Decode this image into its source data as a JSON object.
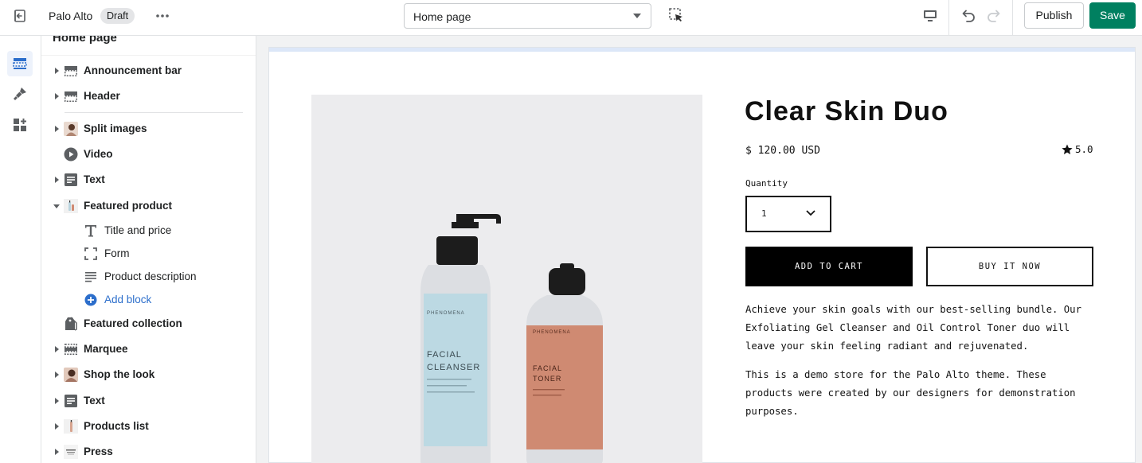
{
  "topbar": {
    "store_name": "Palo Alto",
    "status_badge": "Draft",
    "page_select_value": "Home page",
    "publish_label": "Publish",
    "save_label": "Save",
    "save_color": "#008060"
  },
  "sidebar": {
    "title": "Home page",
    "sections": [
      {
        "label": "Announcement bar",
        "icon": "layout-bar-icon"
      },
      {
        "label": "Header",
        "icon": "layout-header-icon"
      },
      {
        "label": "Split images",
        "icon": "image-thumbnail-icon"
      },
      {
        "label": "Video",
        "icon": "play-circle-icon"
      },
      {
        "label": "Text",
        "icon": "text-block-icon"
      },
      {
        "label": "Featured product",
        "icon": "product-thumbnail-icon",
        "expanded": true,
        "blocks": [
          {
            "label": "Title and price",
            "icon": "type-icon"
          },
          {
            "label": "Form",
            "icon": "form-frame-icon"
          },
          {
            "label": "Product description",
            "icon": "align-left-icon"
          }
        ],
        "add_block_label": "Add block"
      },
      {
        "label": "Featured collection",
        "icon": "collection-tag-icon"
      },
      {
        "label": "Marquee",
        "icon": "layout-bar-icon"
      },
      {
        "label": "Shop the look",
        "icon": "image-thumbnail-icon"
      },
      {
        "label": "Text",
        "icon": "text-block-icon"
      },
      {
        "label": "Products list",
        "icon": "product-thumbnail-icon"
      },
      {
        "label": "Press",
        "icon": "press-logo-icon"
      }
    ]
  },
  "preview": {
    "product_title": "Clear Skin Duo",
    "price": "$ 120.00 USD",
    "rating": "5.0",
    "quantity_label": "Quantity",
    "quantity_value": "1",
    "add_to_cart": "ADD TO CART",
    "buy_now": "BUY IT NOW",
    "description": [
      "Achieve your skin goals with our best-selling bundle. Our Exfoliating Gel Cleanser and Oil Control Toner duo will leave your skin feeling radiant and rejuvenated.",
      "This is a demo store for the Palo Alto theme. These products were created by our designers for demonstration purposes."
    ],
    "bottle_left": {
      "brand": "PHENOMENA",
      "name_line1": "FACIAL",
      "name_line2": "CLEANSER",
      "color": "#bcd9e3"
    },
    "bottle_right": {
      "brand": "PHENOMENA",
      "name_line1": "FACIAL",
      "name_line2": "TONER",
      "color": "#cf8a72"
    }
  }
}
